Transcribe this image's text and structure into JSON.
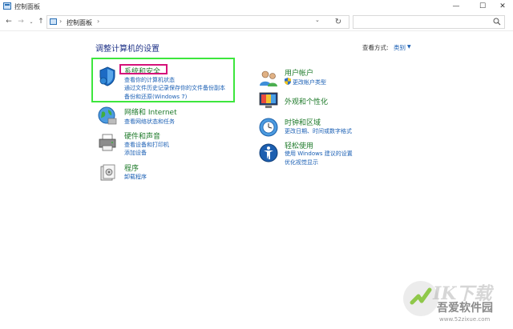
{
  "window": {
    "title": "控制面板",
    "min": "—",
    "max": "☐",
    "close": "✕"
  },
  "nav": {
    "back": "←",
    "forward": "→",
    "dropdown": "⌄",
    "up": "↑",
    "sep": "›",
    "breadcrumb": "控制面板",
    "refresh": "↻",
    "search_placeholder": ""
  },
  "main": {
    "title": "调整计算机的设置",
    "view_by_label": "查看方式:",
    "view_by_value": "类别",
    "view_by_caret": "▼"
  },
  "categories": [
    {
      "title": "系统和安全",
      "links": [
        "查看你的计算机状态",
        "通过文件历史记录保存你的文件备份副本",
        "备份和还原(Windows 7)"
      ]
    },
    {
      "title": "网络和 Internet",
      "links": [
        "查看网络状态和任务"
      ]
    },
    {
      "title": "硬件和声音",
      "links": [
        "查看设备和打印机",
        "添加设备"
      ]
    },
    {
      "title": "程序",
      "links": [
        "卸载程序"
      ]
    },
    {
      "title": "用户帐户",
      "links": [
        "更改帐户类型"
      ]
    },
    {
      "title": "外观和个性化",
      "links": []
    },
    {
      "title": "时钟和区域",
      "links": [
        "更改日期、时间或数字格式"
      ]
    },
    {
      "title": "轻松使用",
      "links": [
        "使用 Windows 建议的设置",
        "优化视觉显示"
      ]
    }
  ],
  "watermark": {
    "line1": "ⅠK下载",
    "line2": "吾爱软件园",
    "line3": "www.52zixue.com"
  },
  "colors": {
    "category_title": "#1e7a2a",
    "link": "#1a5fb4",
    "highlight_green": "#3de63d",
    "highlight_magenta": "#d6127a"
  }
}
